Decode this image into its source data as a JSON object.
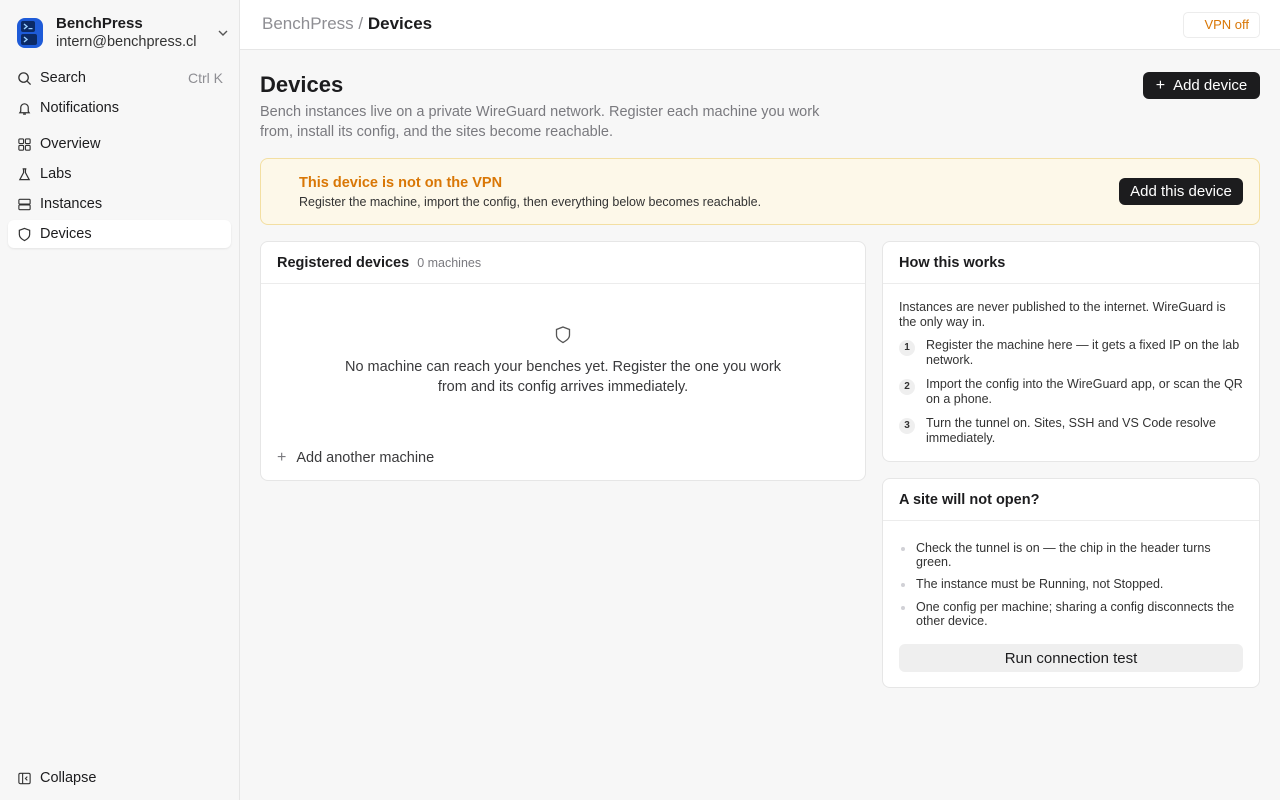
{
  "account": {
    "name": "BenchPress",
    "email": "intern@benchpress.cl"
  },
  "sidebar": {
    "search": {
      "label": "Search",
      "shortcut": "Ctrl K"
    },
    "notifications": "Notifications",
    "items": [
      "Overview",
      "Labs",
      "Instances",
      "Devices"
    ],
    "active": "Devices",
    "collapse": "Collapse"
  },
  "header": {
    "crumb_root": "BenchPress",
    "crumb_sep": " / ",
    "crumb_current": "Devices",
    "vpn_status": "VPN off"
  },
  "page": {
    "title": "Devices",
    "subtitle": "Bench instances live on a private WireGuard network. Register each machine you work from, install its config, and the sites become reachable.",
    "add_device_label": "Add device"
  },
  "banner": {
    "title": "This device is not on the VPN",
    "text": "Register the machine, import the config, then everything below becomes reachable.",
    "button": "Add this device"
  },
  "registered": {
    "title": "Registered devices",
    "count": "0 machines",
    "empty_text": "No machine can reach your benches yet. Register the one you work from and its config arrives immediately.",
    "add_another": "Add another machine"
  },
  "how": {
    "title": "How this works",
    "intro": "Instances are never published to the internet. WireGuard is the only way in.",
    "steps": [
      {
        "num": "1",
        "text": "Register the machine here — it gets a fixed IP on the lab network."
      },
      {
        "num": "2",
        "text": "Import the config into the WireGuard app, or scan the QR on a phone."
      },
      {
        "num": "3",
        "text": "Turn the tunnel on. Sites, SSH and VS Code resolve immediately."
      }
    ]
  },
  "troubleshoot": {
    "title": "A site will not open?",
    "tips": [
      "Check the tunnel is on — the chip in the header turns green.",
      "The instance must be Running, not Stopped.",
      "One config per machine; sharing a config disconnects the other device."
    ],
    "button": "Run connection test"
  },
  "colors": {
    "warning": "#d97706",
    "banner_bg": "#fdf8e9",
    "dark_button": "#1c1c1e"
  }
}
